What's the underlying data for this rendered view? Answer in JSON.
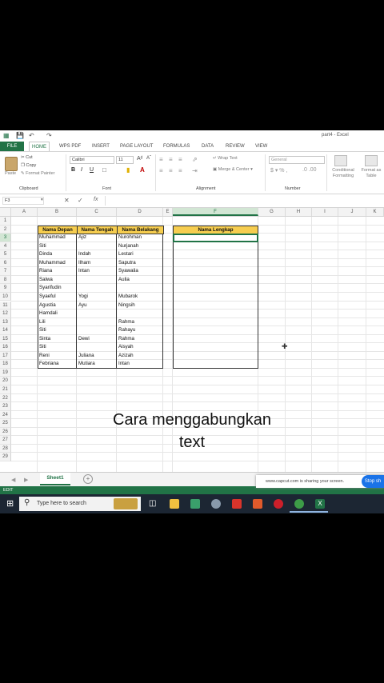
{
  "window": {
    "title": "part4 - Excel"
  },
  "tabs": [
    "FILE",
    "HOME",
    "WPS PDF",
    "INSERT",
    "PAGE LAYOUT",
    "FORMULAS",
    "DATA",
    "REVIEW",
    "VIEW"
  ],
  "ribbon": {
    "cut": "Cut",
    "copy": "Copy",
    "format_painter": "Format Painter",
    "paste": "Paste",
    "font_name": "Calibri",
    "font_size": "11",
    "bold": "B",
    "italic": "I",
    "underline": "U",
    "wrap_text": "Wrap Text",
    "merge_center": "Merge & Center",
    "number_format": "General",
    "conditional_formatting": "Conditional Formatting",
    "format_as_table": "Format as Table",
    "groups": {
      "clipboard": "Clipboard",
      "font": "Font",
      "alignment": "Alignment",
      "number": "Number"
    }
  },
  "formula_bar": {
    "name_box": "F3",
    "fx": "fx",
    "content": ""
  },
  "columns": [
    "A",
    "B",
    "C",
    "D",
    "E",
    "F",
    "G",
    "H",
    "I",
    "J",
    "K"
  ],
  "rows": [
    "1",
    "2",
    "3",
    "4",
    "5",
    "6",
    "7",
    "8",
    "9",
    "10",
    "11",
    "12",
    "13",
    "14",
    "15",
    "16",
    "17",
    "18",
    "19",
    "20",
    "21",
    "22",
    "23",
    "24",
    "25",
    "26",
    "27",
    "28",
    "29"
  ],
  "table": {
    "headers": [
      "Nama Depan",
      "Nama Tengah",
      "Nama Belakang"
    ],
    "rows": [
      [
        "Muhammad",
        "Ajiz",
        "Nurohman"
      ],
      [
        "Siti",
        "",
        "Nurjanah"
      ],
      [
        "Dinda",
        "Indah",
        "Lestari"
      ],
      [
        "Muhammad",
        "Ilham",
        "Saputra"
      ],
      [
        "Riana",
        "Intan",
        "Syawalia"
      ],
      [
        "Salwa",
        "",
        "Aulia"
      ],
      [
        "Syarifudin",
        "",
        ""
      ],
      [
        "Syaeful",
        "Yogi",
        "Mubarok"
      ],
      [
        "Agustia",
        "Ayu",
        "Ningsih"
      ],
      [
        "Hamdali",
        "",
        ""
      ],
      [
        "Lili",
        "",
        "Rahma"
      ],
      [
        "Siti",
        "",
        "Rahayu"
      ],
      [
        "Sinta",
        "Dewi",
        "Rahma"
      ],
      [
        "Siti",
        "",
        "Aisyah"
      ],
      [
        "Reni",
        "Juliana",
        "Azizah"
      ],
      [
        "Febriana",
        "Mutiara",
        "Intan"
      ]
    ],
    "result_header": "Nama Lengkap"
  },
  "sheet": {
    "tab": "Sheet1",
    "add": "+"
  },
  "status": {
    "mode": "EDIT"
  },
  "taskbar": {
    "search_placeholder": "Type here to search"
  },
  "share_banner": {
    "text": "www.capcut.com is sharing your screen.",
    "stop_label": "Stop sh"
  },
  "caption": {
    "line1": "Cara menggabungkan",
    "line2": "text"
  },
  "colors": {
    "excel_green": "#217346",
    "header_fill": "#f6cd4f",
    "taskbar": "#1c2633"
  }
}
